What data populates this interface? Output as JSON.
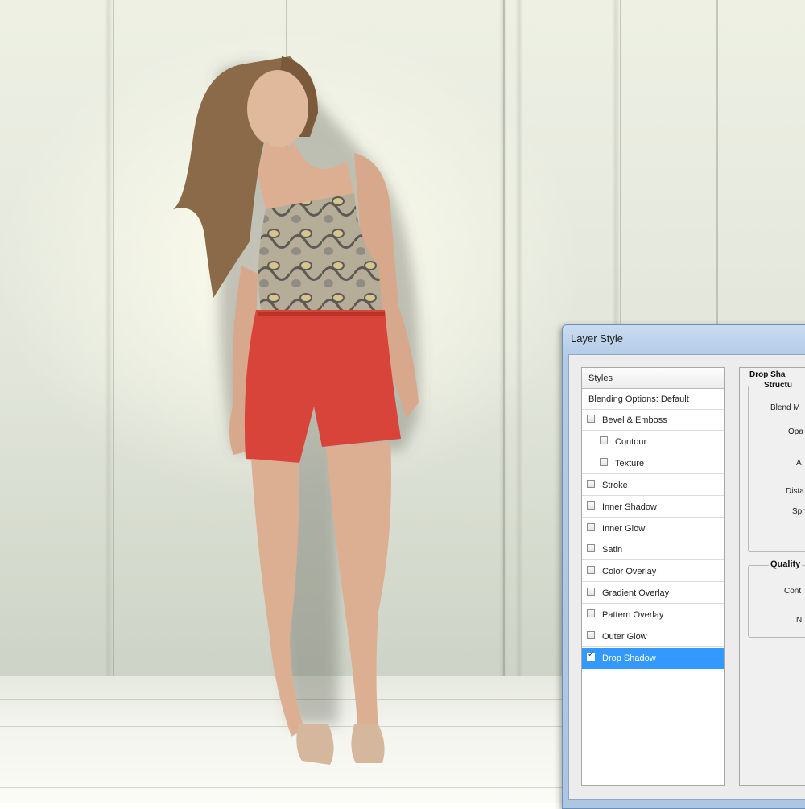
{
  "dialog": {
    "title": "Layer Style",
    "styles_list": {
      "header": "Styles",
      "blending_options": "Blending Options: Default",
      "items": [
        {
          "label": "Bevel & Emboss",
          "checked": false,
          "indent": false
        },
        {
          "label": "Contour",
          "checked": false,
          "indent": true
        },
        {
          "label": "Texture",
          "checked": false,
          "indent": true
        },
        {
          "label": "Stroke",
          "checked": false,
          "indent": false
        },
        {
          "label": "Inner Shadow",
          "checked": false,
          "indent": false
        },
        {
          "label": "Inner Glow",
          "checked": false,
          "indent": false
        },
        {
          "label": "Satin",
          "checked": false,
          "indent": false
        },
        {
          "label": "Color Overlay",
          "checked": false,
          "indent": false
        },
        {
          "label": "Gradient Overlay",
          "checked": false,
          "indent": false
        },
        {
          "label": "Pattern Overlay",
          "checked": false,
          "indent": false
        },
        {
          "label": "Outer Glow",
          "checked": false,
          "indent": false
        },
        {
          "label": "Drop Shadow",
          "checked": true,
          "indent": false,
          "selected": true
        }
      ]
    },
    "drop_shadow_panel": {
      "title": "Drop Sha",
      "structure_title": "Structu",
      "fields": [
        "Blend M",
        "Opa",
        "A",
        "Dista",
        "Spr"
      ],
      "quality_title": "Quality",
      "quality_fields": [
        "Cont",
        "N"
      ]
    }
  },
  "colors": {
    "selection": "#3399ff",
    "shorts": "#d9443a",
    "dialog_frame": "#adc6e2"
  }
}
